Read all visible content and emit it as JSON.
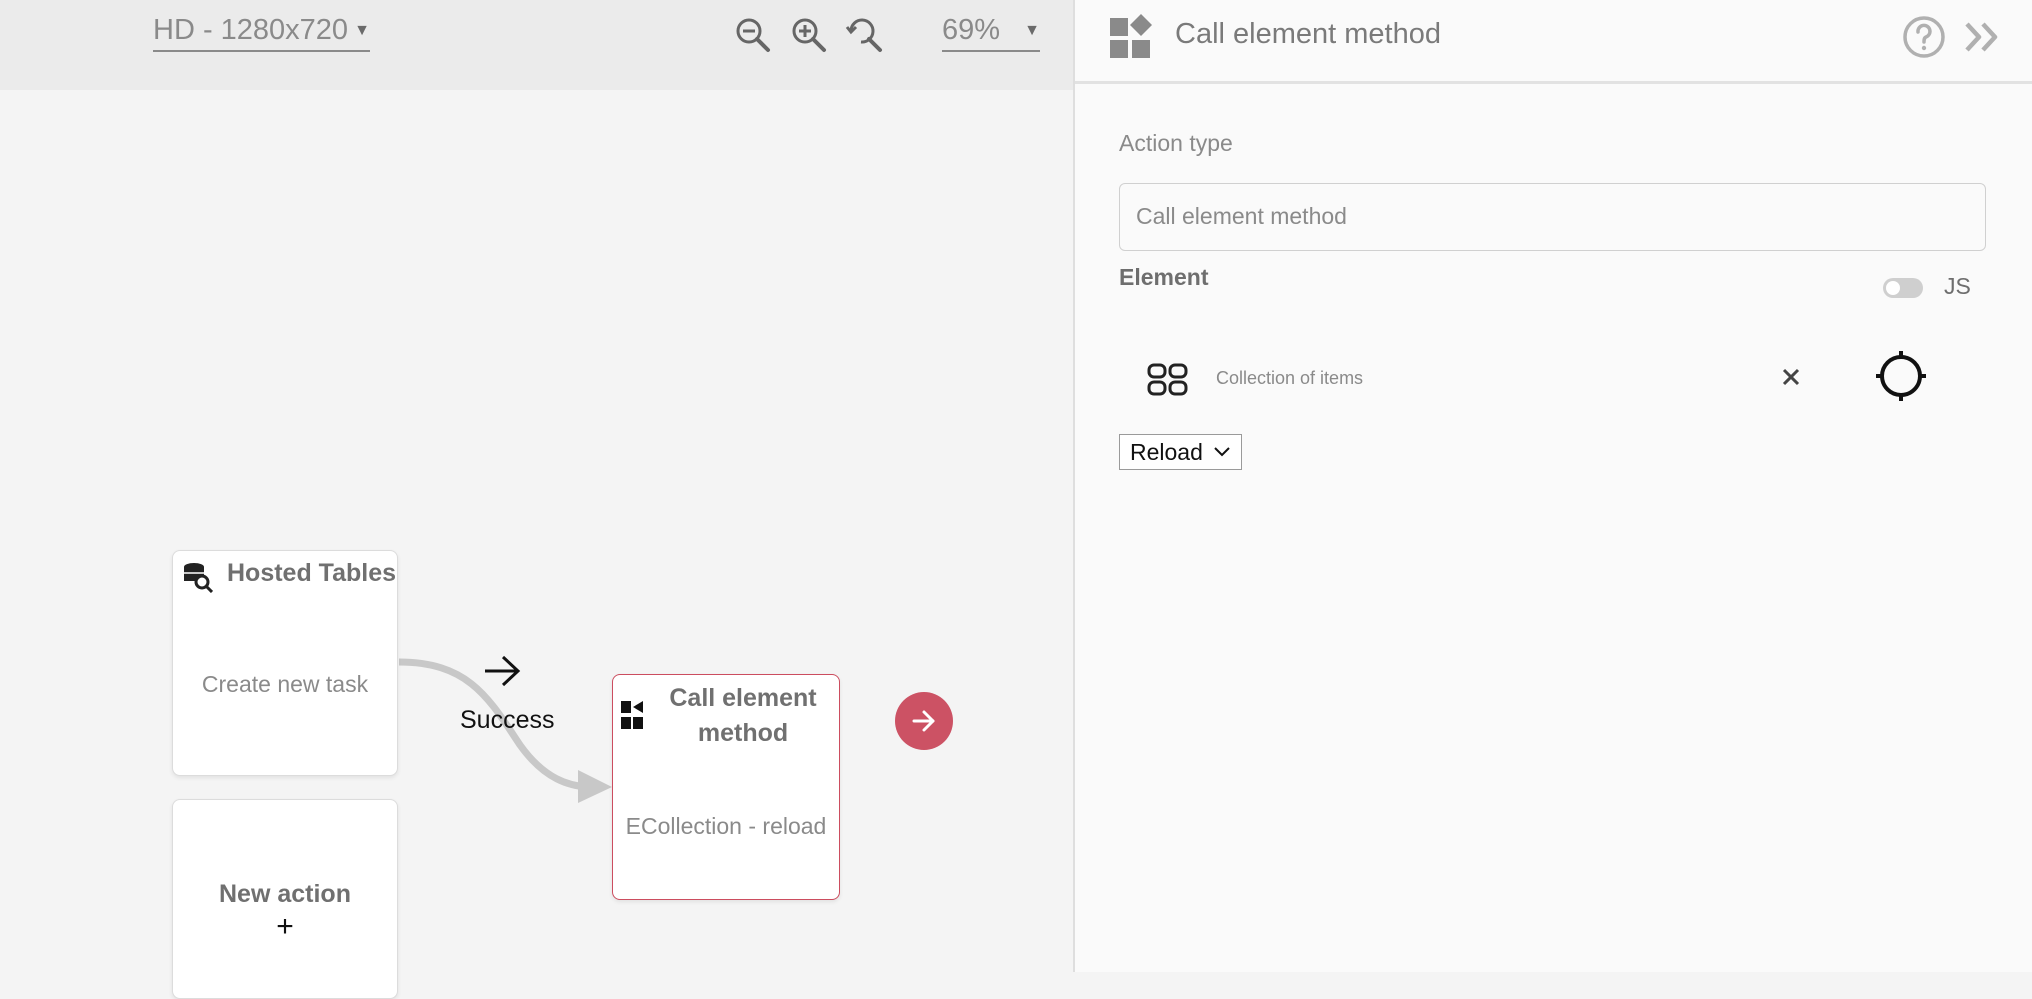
{
  "toolbar": {
    "resolution": "HD - 1280x720",
    "zoom_level": "69%",
    "icons": [
      "zoom-out-icon",
      "zoom-in-icon",
      "zoom-reset-icon",
      "chevron-down-icon"
    ]
  },
  "canvas": {
    "nodes": {
      "hosted_tables": {
        "title": "Hosted Tables",
        "subtitle": "Create new task",
        "icon": "database-search-icon"
      },
      "call_element": {
        "title_line1": "Call element",
        "title_line2": "method",
        "subtitle": "ECollection - reload",
        "icon": "widgets-icon"
      },
      "new_action": {
        "title": "New action",
        "plus": "+"
      }
    },
    "connector": {
      "label": "Success"
    },
    "run_icon": "arrow-right-icon"
  },
  "panel": {
    "title": "Call element method",
    "header_icon": "widgets-icon",
    "help_icon": "help-circle-icon",
    "collapse_icon": "double-chevron-right-icon",
    "action_type_label": "Action type",
    "action_type_value": "Call element method",
    "element_label": "Element",
    "js_label": "JS",
    "js_toggle_on": false,
    "element_name": "Collection of items",
    "element_icon": "collection-grid-icon",
    "clear_icon": "close-icon",
    "target_icon": "crosshair-icon",
    "method_selected": "Reload"
  },
  "colors": {
    "accent": "#cc5264",
    "canvas_bg": "#f4f4f4",
    "toolbar_bg": "#ebebeb",
    "panel_bg": "#fafafa"
  }
}
